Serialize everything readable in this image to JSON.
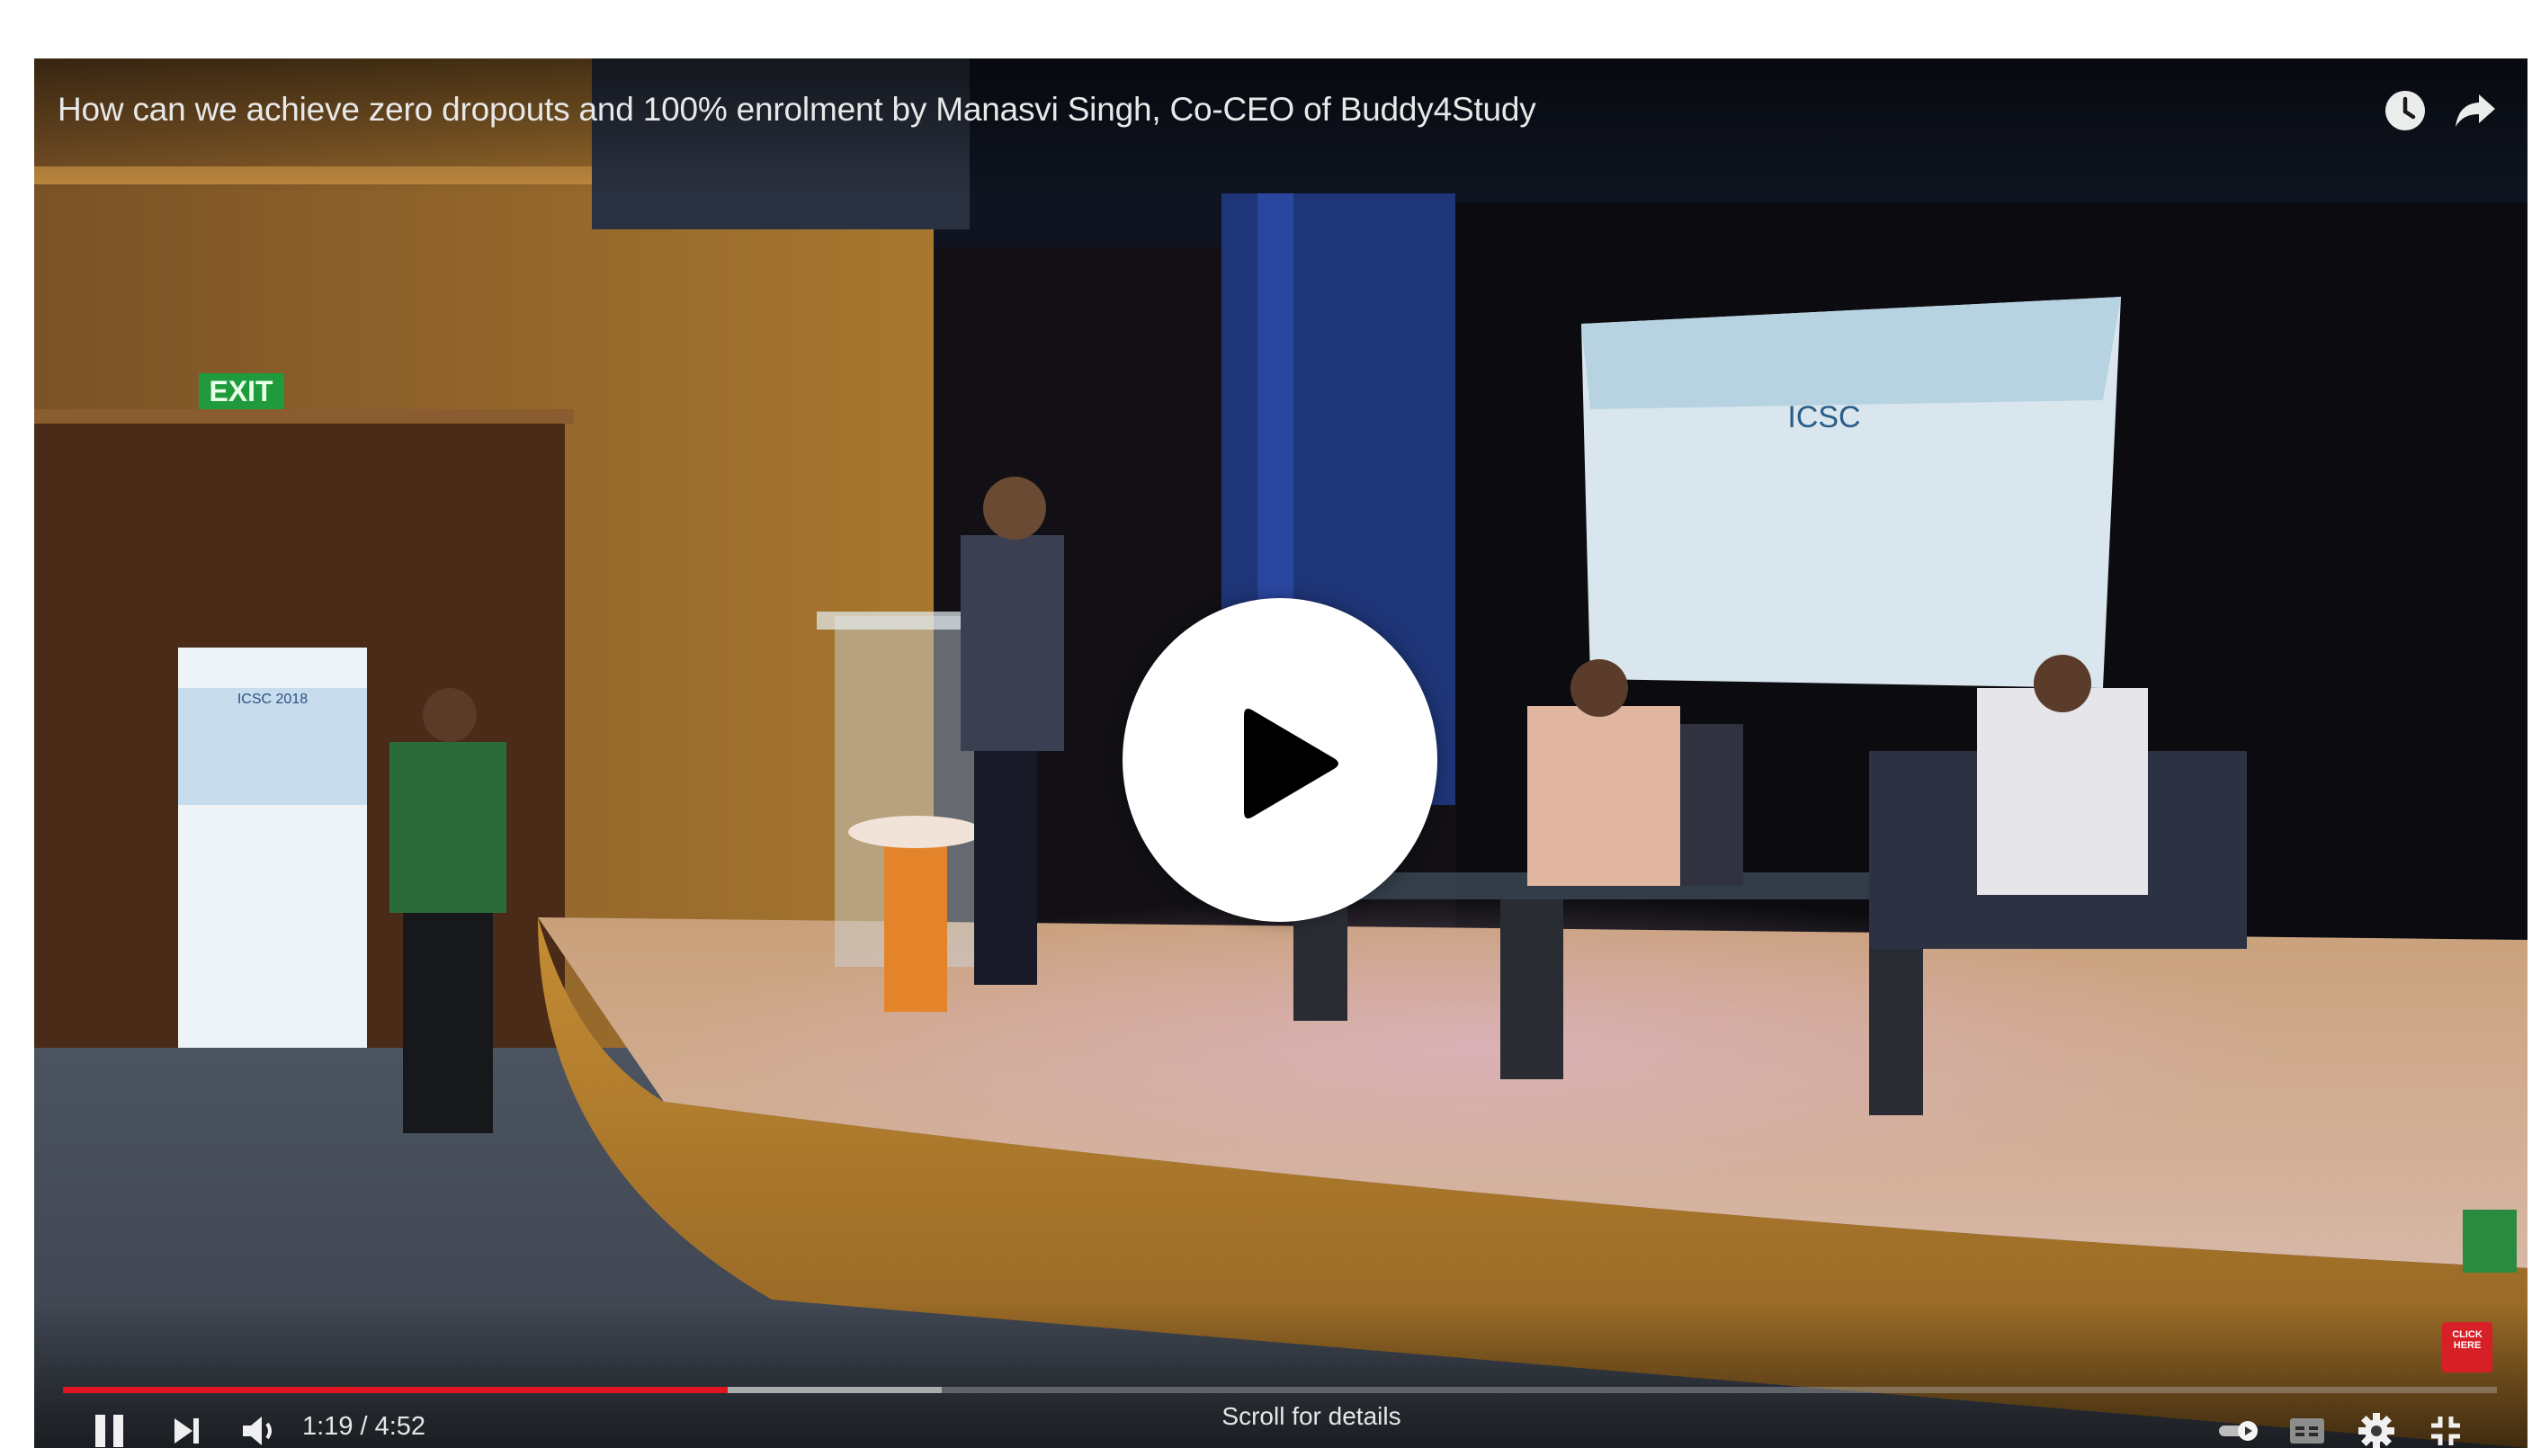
{
  "player": {
    "title": "How can we achieve zero dropouts and 100% enrolment by Manasvi Singh, Co-CEO of Buddy4Study",
    "top_icons": [
      "watch-later-icon",
      "share-icon"
    ],
    "scene": {
      "exit_sign": "EXIT",
      "banner_text": "ICSC 2018",
      "backdrop_text": "ICSC"
    },
    "cta_badge": "CLICK HERE",
    "progress": {
      "played": 0.273,
      "buffered": 0.361
    },
    "controls": {
      "time": "1:19 / 4:52",
      "scroll_hint": "Scroll for details",
      "left_icons": [
        "pause-icon",
        "next-icon",
        "volume-icon"
      ],
      "right_icons": [
        "autoplay-toggle-icon",
        "captions-icon",
        "settings-icon",
        "exit-fullscreen-icon"
      ]
    },
    "colors": {
      "progress_played": "#e0141e",
      "accent": "#ffffff"
    }
  }
}
